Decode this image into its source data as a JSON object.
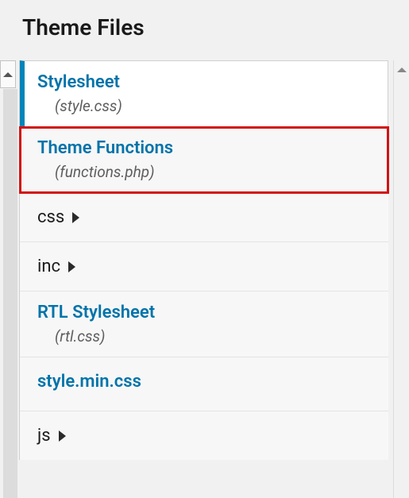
{
  "heading": "Theme Files",
  "files": [
    {
      "title": "Stylesheet",
      "subtitle": "(style.css)",
      "selected": true,
      "highlighted": false
    },
    {
      "title": "Theme Functions",
      "subtitle": "(functions.php)",
      "selected": false,
      "highlighted": true
    },
    {
      "folder": "css"
    },
    {
      "folder": "inc"
    },
    {
      "title": "RTL Stylesheet",
      "subtitle": "(rtl.css)",
      "selected": false,
      "highlighted": false
    },
    {
      "single": "style.min.css"
    },
    {
      "folder": "js"
    }
  ]
}
